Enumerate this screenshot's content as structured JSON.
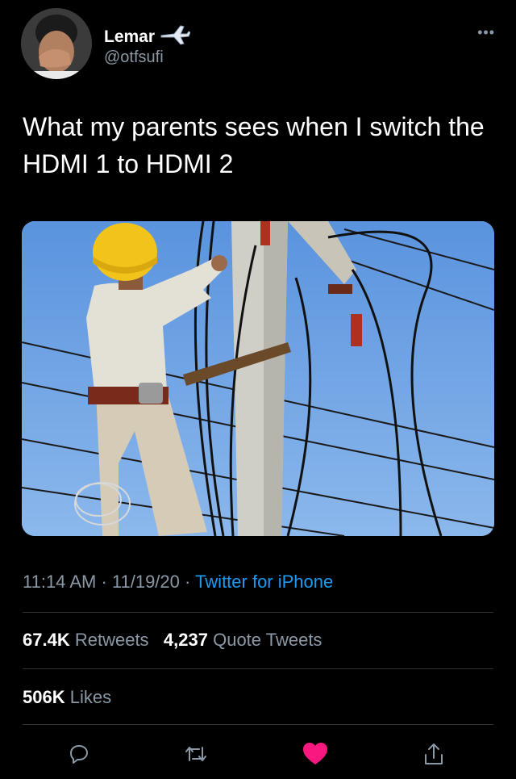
{
  "user": {
    "display_name": "Lemar",
    "handle": "@otfsufi",
    "badge_emoji": "🛩"
  },
  "tweet": {
    "text": "What my parents sees when I switch the HDMI 1 to HDMI 2"
  },
  "meta": {
    "time": "11:14 AM",
    "date": "11/19/20",
    "separator": " · ",
    "source": "Twitter for iPhone"
  },
  "stats": {
    "retweets_count": "67.4K",
    "retweets_label": "Retweets",
    "quotes_count": "4,237",
    "quotes_label": "Quote Tweets",
    "likes_count": "506K",
    "likes_label": "Likes"
  },
  "actions": {
    "icons": [
      "reply-icon",
      "retweet-icon",
      "like-icon",
      "share-icon"
    ],
    "like_color": "#f91880",
    "icon_color": "#8b98a5"
  },
  "colors": {
    "background": "#000000",
    "text": "#ffffff",
    "secondary": "#8b98a5",
    "link": "#1d9bf0",
    "divider": "#2f3336"
  }
}
